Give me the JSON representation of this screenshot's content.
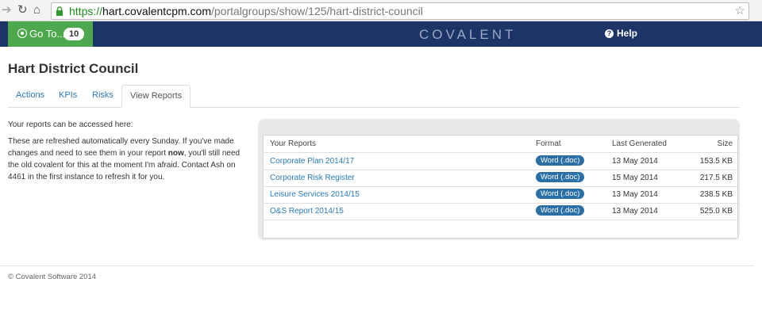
{
  "browser": {
    "back_icon": "back-arrow-icon",
    "reload_icon": "reload-icon",
    "home_icon": "home-icon",
    "url_scheme": "https://",
    "url_host": "hart.covalentcpm.com",
    "url_path": "/portalgroups/show/125/hart-district-council"
  },
  "header": {
    "goto_label": "Go To...",
    "goto_count": "10",
    "brand": "COVALENT",
    "help_label": "Help"
  },
  "page": {
    "title": "Hart District Council",
    "tabs": [
      {
        "label": "Actions"
      },
      {
        "label": "KPIs"
      },
      {
        "label": "Risks"
      },
      {
        "label": "View Reports",
        "active": true
      }
    ],
    "intro": "Your reports can be accessed here:",
    "desc_before": "These are refreshed automatically every Sunday. If you've made changes and need to see them in your report ",
    "desc_bold": "now",
    "desc_after": ", you'll still need the old covalent for this at the moment I'm afraid. Contact Ash on 4461 in the first instance to refresh it for you."
  },
  "reports": {
    "headers": {
      "name": "Your Reports",
      "format": "Format",
      "date": "Last Generated",
      "size": "Size"
    },
    "rows": [
      {
        "name": "Corporate Plan 2014/17",
        "format": "Word (.doc)",
        "date": "13 May 2014",
        "size": "153.5 KB"
      },
      {
        "name": "Corporate Risk Register",
        "format": "Word (.doc)",
        "date": "15 May 2014",
        "size": "217.5 KB"
      },
      {
        "name": "Leisure Services 2014/15",
        "format": "Word (.doc)",
        "date": "13 May 2014",
        "size": "238.5 KB"
      },
      {
        "name": "O&S Report 2014/15",
        "format": "Word (.doc)",
        "date": "13 May 2014",
        "size": "525.0 KB"
      }
    ]
  },
  "footer": {
    "text": "© Covalent Software 2014"
  },
  "colors": {
    "header_bg": "#1d3467",
    "goto_bg": "#4ea84e",
    "link": "#2a7ab8",
    "badge": "#2a6fa6"
  }
}
